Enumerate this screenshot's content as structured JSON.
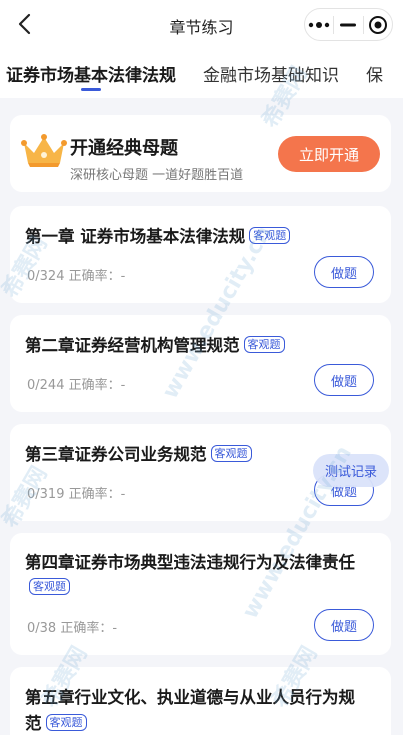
{
  "navbar": {
    "title": "章节练习",
    "back_icon": "chevron-left-icon",
    "more_icon": "more-dots-icon",
    "minimize_icon": "minimize-icon",
    "close_icon": "target-circle-icon"
  },
  "tabs": [
    {
      "label": "证券市场基本法律法规",
      "active": true
    },
    {
      "label": "金融市场基础知识",
      "active": false
    },
    {
      "label": "保",
      "active": false
    }
  ],
  "promo": {
    "title": "开通经典母题",
    "subtitle": "深研核心母题 一道好题胜百道",
    "button": "立即开通",
    "icon": "crown-icon"
  },
  "chapters": [
    {
      "title": "第一章 证券市场基本法律法规",
      "badge": "客观题",
      "stats": "0/324 正确率：-",
      "button": "做题"
    },
    {
      "title": "第二章证券经营机构管理规范",
      "badge": "客观题",
      "stats": "0/244 正确率：-",
      "button": "做题"
    },
    {
      "title": "第三章证券公司业务规范",
      "badge": "客观题",
      "stats": "0/319 正确率：-",
      "button": "做题"
    },
    {
      "title": "第四章证券市场典型违法违规行为及法律责任",
      "badge": "客观题",
      "stats": "0/38 正确率：-",
      "button": "做题"
    },
    {
      "title": "第五章行业文化、执业道德与从业人员行为规范",
      "badge": "客观题"
    }
  ],
  "floating_button": "测试记录",
  "colors": {
    "accent": "#3a5ad9",
    "promo_button": "#f4754c",
    "background": "#f4f5f9"
  },
  "watermark": {
    "brand": "希赛网",
    "url": "www.educity.cn"
  }
}
